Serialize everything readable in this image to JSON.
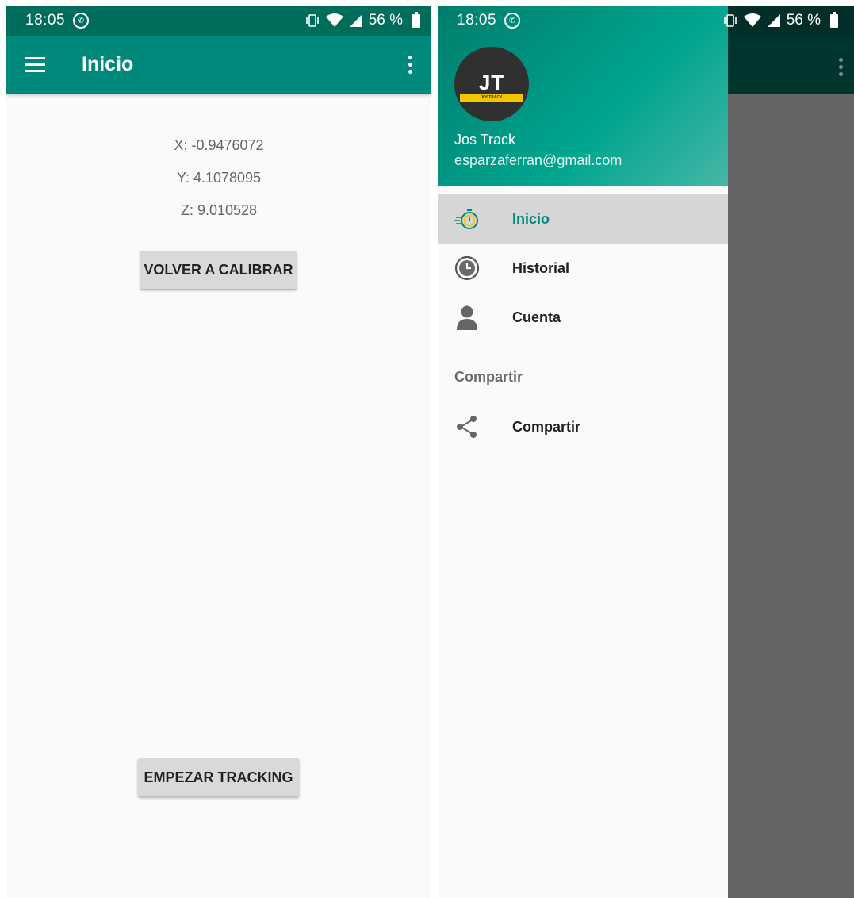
{
  "status_bar": {
    "time": "18:05",
    "battery": "56 %"
  },
  "left_screen": {
    "app_bar": {
      "title": "Inicio"
    },
    "sensor": {
      "x": "X: -0.9476072",
      "y": "Y: 4.1078095",
      "z": "Z: 9.010528"
    },
    "buttons": {
      "recalibrate": "VOLVER A CALIBRAR",
      "start_tracking": "EMPEZAR TRACKING"
    }
  },
  "drawer": {
    "header": {
      "avatar_initials": "JT",
      "avatar_caption": "JOSTRACK",
      "name": "Jos Track",
      "email": "esparzaferran@gmail.com"
    },
    "items": [
      {
        "label": "Inicio",
        "icon": "stopwatch-icon",
        "active": true
      },
      {
        "label": "Historial",
        "icon": "history-clock-icon"
      },
      {
        "label": "Cuenta",
        "icon": "person-icon"
      }
    ],
    "section": {
      "title": "Compartir"
    },
    "share_item": {
      "label": "Compartir",
      "icon": "share-icon"
    }
  },
  "colors": {
    "primary": "#00897b",
    "primary_dark": "#006d5b",
    "button": "#d9d9d9",
    "scrim": "#656565"
  }
}
